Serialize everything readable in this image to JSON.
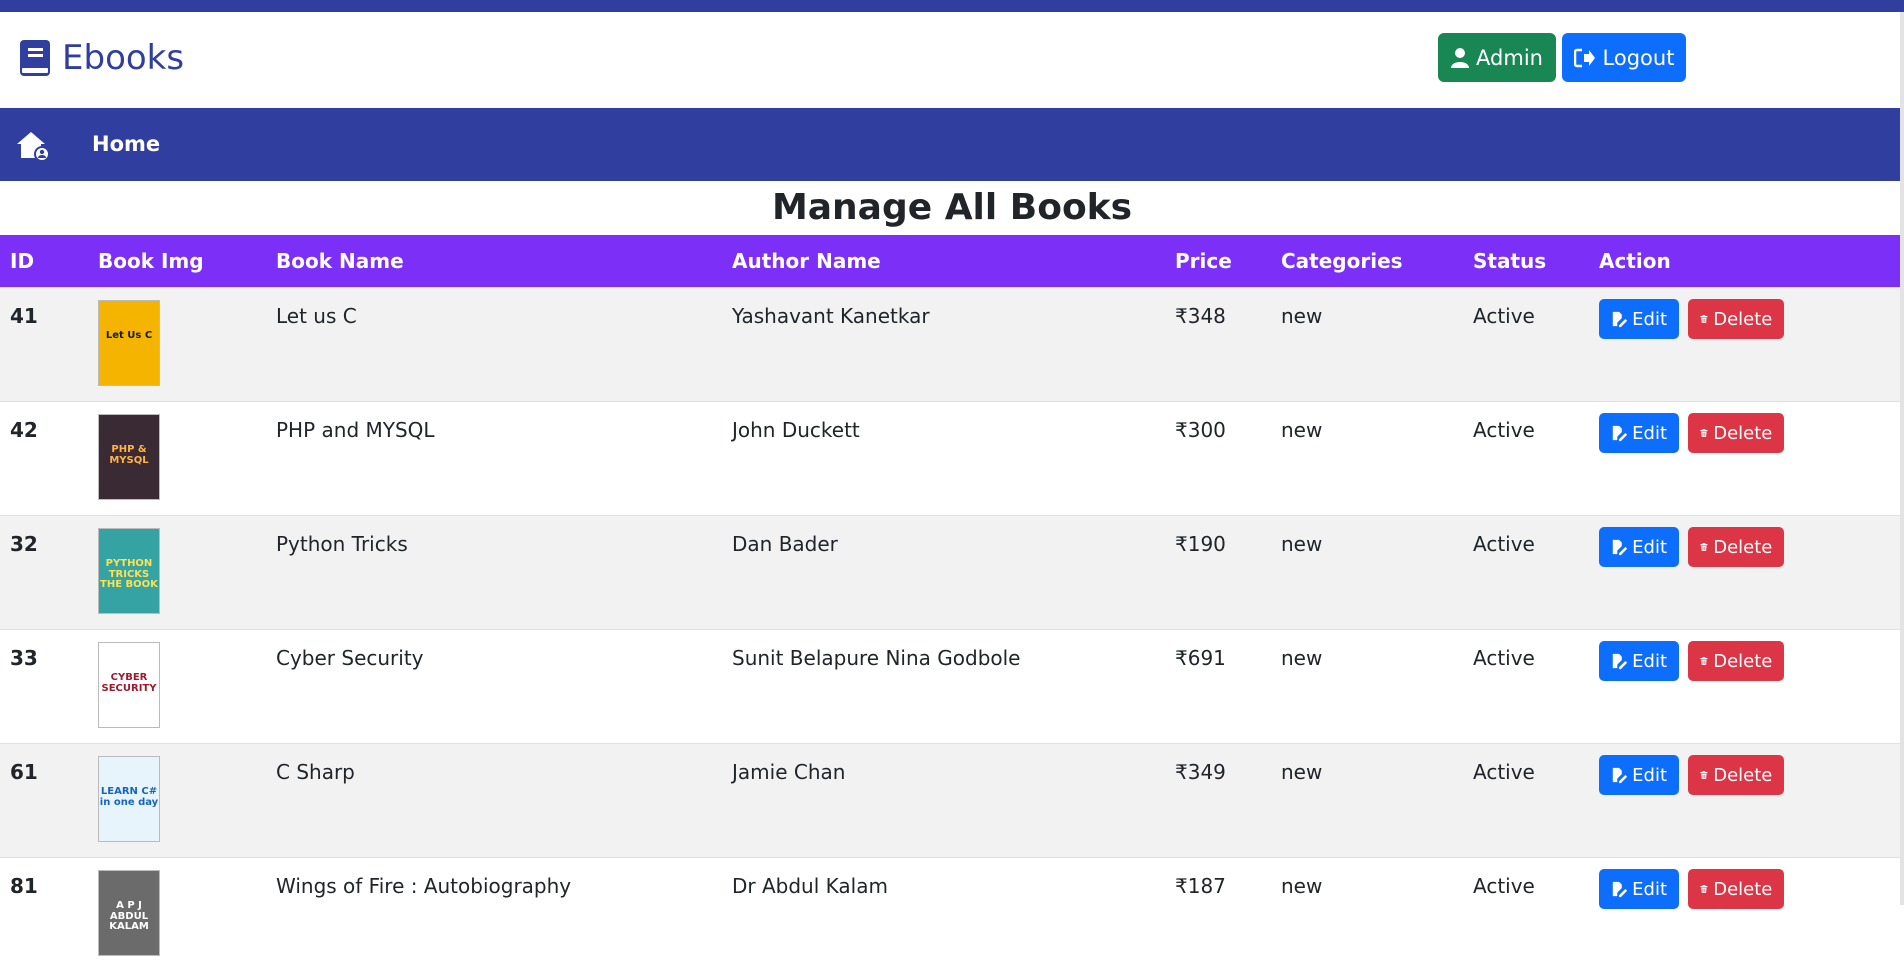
{
  "brand": {
    "title": "Ebooks",
    "color": "#303f9f"
  },
  "header": {
    "admin_label": "Admin",
    "logout_label": "Logout"
  },
  "nav": {
    "home_label": "Home"
  },
  "page": {
    "title": "Manage All Books"
  },
  "table": {
    "headers": [
      "ID",
      "Book Img",
      "Book Name",
      "Author Name",
      "Price",
      "Categories",
      "Status",
      "Action"
    ],
    "edit_label": "Edit",
    "delete_label": "Delete",
    "rows": [
      {
        "id": "41",
        "name": "Let us C",
        "author": "Yashavant Kanetkar",
        "price": "₹348",
        "category": "new",
        "status": "Active",
        "cover": {
          "bg": "#f4b400",
          "fg": "#1a1a1a",
          "text": "Let Us C"
        }
      },
      {
        "id": "42",
        "name": "PHP and MYSQL",
        "author": "John Duckett",
        "price": "₹300",
        "category": "new",
        "status": "Active",
        "cover": {
          "bg": "#3a2a34",
          "fg": "#ffb347",
          "text": "PHP & MYSQL"
        }
      },
      {
        "id": "32",
        "name": "Python Tricks",
        "author": "Dan Bader",
        "price": "₹190",
        "category": "new",
        "status": "Active",
        "cover": {
          "bg": "#35a3a3",
          "fg": "#ffe14d",
          "text": "PYTHON TRICKS THE BOOK"
        }
      },
      {
        "id": "33",
        "name": "Cyber Security",
        "author": "Sunit Belapure Nina Godbole",
        "price": "₹691",
        "category": "new",
        "status": "Active",
        "cover": {
          "bg": "#ffffff",
          "fg": "#9b1b30",
          "text": "CYBER SECURITY"
        }
      },
      {
        "id": "61",
        "name": "C Sharp",
        "author": "Jamie Chan",
        "price": "₹349",
        "category": "new",
        "status": "Active",
        "cover": {
          "bg": "#e8f4fb",
          "fg": "#1565c0",
          "text": "LEARN C# in one day"
        }
      },
      {
        "id": "81",
        "name": "Wings of Fire : Autobiography",
        "author": "Dr Abdul Kalam",
        "price": "₹187",
        "category": "new",
        "status": "Active",
        "cover": {
          "bg": "#6b6b6b",
          "fg": "#ffffff",
          "text": "A P J ABDUL KALAM"
        }
      }
    ]
  },
  "colors": {
    "topbar": "#303f9f",
    "table_header": "#7b2ff7",
    "admin_button": "#198754",
    "primary_button": "#0d6efd",
    "danger_button": "#dc3545"
  }
}
